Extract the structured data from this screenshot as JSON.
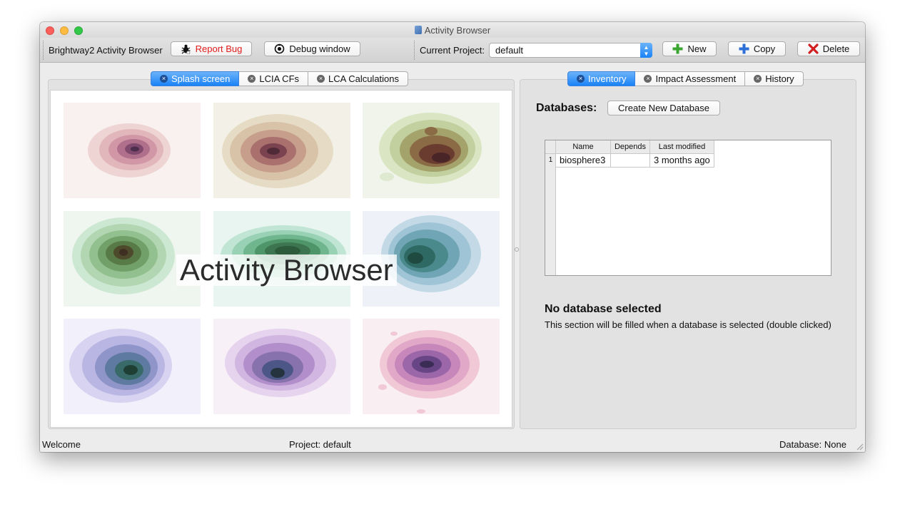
{
  "window": {
    "title": "Activity Browser"
  },
  "toolbar": {
    "app_label": "Brightway2 Activity Browser",
    "report_bug_label": "Report Bug",
    "debug_window_label": "Debug window",
    "current_project_label": "Current Project:",
    "project_value": "default",
    "new_label": "New",
    "copy_label": "Copy",
    "delete_label": "Delete"
  },
  "left_panel": {
    "tabs": [
      {
        "label": "Splash screen",
        "active": true
      },
      {
        "label": "LCIA CFs",
        "active": false
      },
      {
        "label": "LCA Calculations",
        "active": false
      }
    ],
    "splash_title": "Activity Browser"
  },
  "right_panel": {
    "tabs": [
      {
        "label": "Inventory",
        "active": true
      },
      {
        "label": "Impact Assessment",
        "active": false
      },
      {
        "label": "History",
        "active": false
      }
    ],
    "databases_label": "Databases:",
    "create_db_label": "Create New Database",
    "table": {
      "columns": [
        "Name",
        "Depends",
        "Last modified"
      ],
      "rows": [
        {
          "index": "1",
          "name": "biosphere3",
          "depends": "",
          "last_modified": "3 months ago"
        }
      ]
    },
    "no_selection_title": "No database selected",
    "no_selection_text": "This section will be filled when a database is selected (double clicked)"
  },
  "status_bar": {
    "left": "Welcome",
    "center": "Project: default",
    "right": "Database: None"
  },
  "colors": {
    "accent_blue": "#1a82f7",
    "bug_red": "#e01b1b",
    "new_green": "#3aa52f",
    "copy_blue": "#2c6fd6",
    "delete_red": "#d11f1f"
  }
}
